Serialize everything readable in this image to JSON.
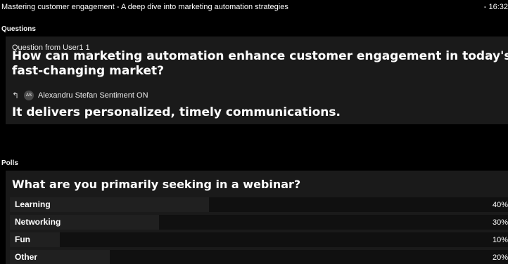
{
  "header": {
    "title": "Mastering customer engagement - A deep dive into marketing automation strategies",
    "time": "- 16:32"
  },
  "questions": {
    "section_label": "Questions",
    "item": {
      "meta": "Question from User1 1",
      "text": "How can marketing automation enhance customer engagement in today's fast-changing market?",
      "reply_icon": "reply-arrow-icon",
      "answer_author_initials": "AS",
      "answer_author_line": "Alexandru Stefan Sentiment ON",
      "answer_text": "It delivers personalized, timely communications."
    }
  },
  "polls": {
    "section_label": "Polls",
    "question": "What are you primarily seeking in a webinar?",
    "options": [
      {
        "label": "Learning",
        "percent_label": "40%",
        "percent": 40
      },
      {
        "label": "Networking",
        "percent_label": "30%",
        "percent": 30
      },
      {
        "label": "Fun",
        "percent_label": "10%",
        "percent": 10
      },
      {
        "label": "Other",
        "percent_label": "20%",
        "percent": 20
      }
    ]
  },
  "colors": {
    "background": "#000000",
    "panel": "#1a1a1a",
    "text": "#ffffff"
  }
}
